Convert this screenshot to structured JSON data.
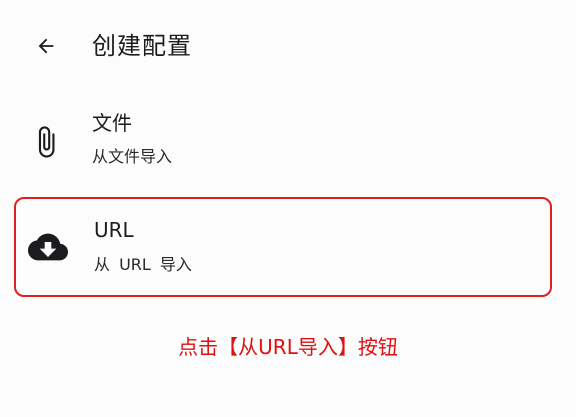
{
  "app_bar": {
    "back_icon": "arrow-left-icon",
    "title": "创建配置"
  },
  "options": [
    {
      "icon": "paperclip-icon",
      "title": "文件",
      "subtitle": "从文件导入"
    },
    {
      "icon": "cloud-download-icon",
      "title": "URL",
      "subtitle": "从 URL 导入",
      "highlighted": true
    }
  ],
  "instruction": "点击【从URL导入】按钮",
  "colors": {
    "highlight_border": "#e02020",
    "instruction_text": "#e01010",
    "background": "#fcfcfc",
    "text": "#1c1b1f"
  }
}
